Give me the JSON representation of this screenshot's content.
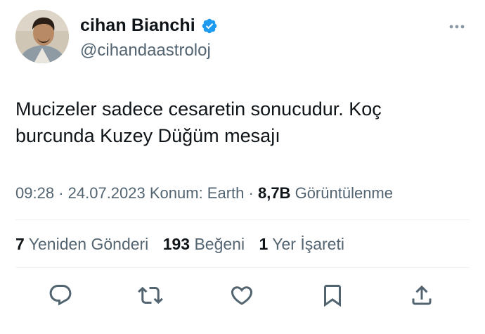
{
  "author": {
    "display_name": "cihan Bianchi",
    "handle": "@cihandaastroloj",
    "verified": true,
    "avatar_icon": "profile-photo"
  },
  "tweet": {
    "text_line1": "Mucizeler sadece cesaretin sonucudur. Koç",
    "text_line2": "burcunda Kuzey Düğüm mesajı"
  },
  "meta": {
    "time": "09:28",
    "separator": "·",
    "date": "24.07.2023",
    "location": "Konum: Earth",
    "views_count": "8,7B",
    "views_label": "Görüntülenme"
  },
  "stats": {
    "reposts_count": "7",
    "reposts_label": "Yeniden Gönderi",
    "likes_count": "193",
    "likes_label": "Beğeni",
    "bookmarks_count": "1",
    "bookmarks_label": "Yer İşareti"
  },
  "actions": [
    {
      "name": "reply",
      "icon": "reply-icon"
    },
    {
      "name": "repost",
      "icon": "repost-icon"
    },
    {
      "name": "like",
      "icon": "heart-icon"
    },
    {
      "name": "bookmark",
      "icon": "bookmark-icon"
    },
    {
      "name": "share",
      "icon": "share-icon"
    }
  ],
  "colors": {
    "text": "#0f1419",
    "secondary": "#536471",
    "verified_badge": "#1d9bf0",
    "divider": "#eff3f4"
  }
}
